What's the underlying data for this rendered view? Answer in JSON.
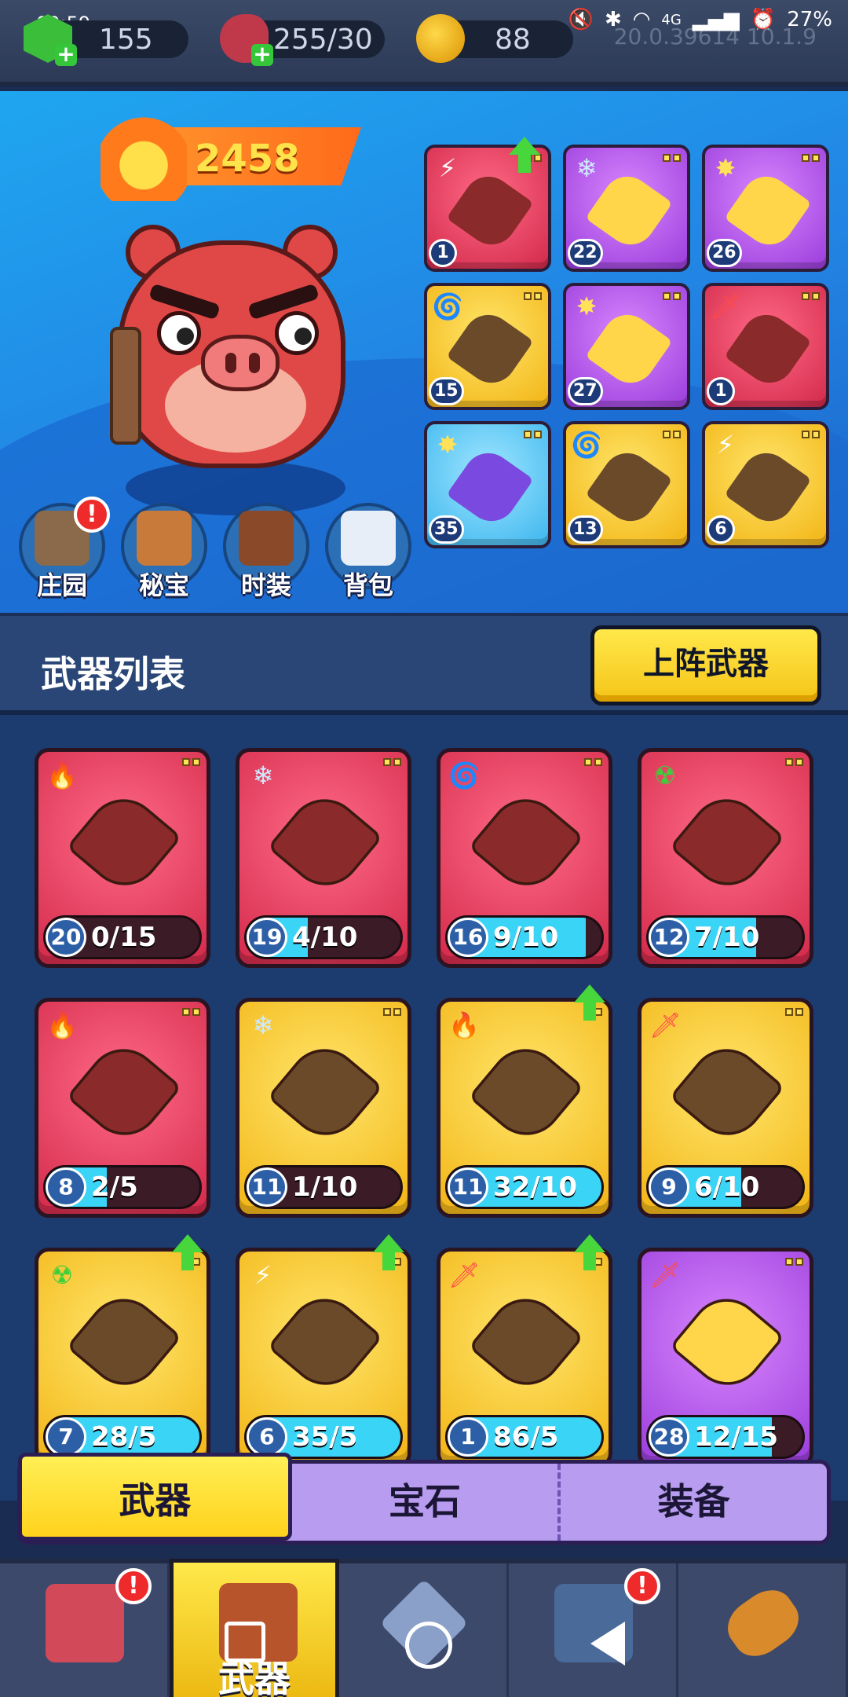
{
  "status": {
    "time": "00:59",
    "battery": "27%",
    "network": "4G",
    "version_text": "20.0.39614 10.1.9"
  },
  "resources": {
    "gems": "155",
    "energy": "255/30",
    "coins": "88"
  },
  "hero": {
    "power": "2458"
  },
  "equipped": [
    {
      "level": "1",
      "element": "lightning",
      "bg": "red",
      "upgrade": true
    },
    {
      "level": "22",
      "element": "ice",
      "bg": "purple"
    },
    {
      "level": "26",
      "element": "burst",
      "bg": "purple"
    },
    {
      "level": "15",
      "element": "wind",
      "bg": "yellow"
    },
    {
      "level": "27",
      "element": "burst",
      "bg": "purple"
    },
    {
      "level": "1",
      "element": "sword",
      "bg": "red"
    },
    {
      "level": "35",
      "element": "burst",
      "bg": "blue"
    },
    {
      "level": "13",
      "element": "wind",
      "bg": "yellow"
    },
    {
      "level": "6",
      "element": "lightning",
      "bg": "yellow"
    }
  ],
  "hero_menu": [
    {
      "label": "庄园",
      "alert": "!"
    },
    {
      "label": "秘宝"
    },
    {
      "label": "时装"
    },
    {
      "label": "背包"
    }
  ],
  "weapon_list": {
    "title": "武器列表",
    "deploy_button": "上阵武器"
  },
  "weapons": [
    {
      "level": "20",
      "count": "0/15",
      "fill": 0.0,
      "bg": "red",
      "element": "fire"
    },
    {
      "level": "19",
      "count": "4/10",
      "fill": 0.4,
      "bg": "red",
      "element": "ice"
    },
    {
      "level": "16",
      "count": "9/10",
      "fill": 0.9,
      "bg": "red",
      "element": "wind"
    },
    {
      "level": "12",
      "count": "7/10",
      "fill": 0.7,
      "bg": "red",
      "element": "poison"
    },
    {
      "level": "8",
      "count": "2/5",
      "fill": 0.4,
      "bg": "red",
      "element": "fire"
    },
    {
      "level": "11",
      "count": "1/10",
      "fill": 0.1,
      "bg": "yellow",
      "element": "ice"
    },
    {
      "level": "11",
      "count": "32/10",
      "fill": 1.0,
      "bg": "yellow",
      "element": "fire",
      "upgrade": true
    },
    {
      "level": "9",
      "count": "6/10",
      "fill": 0.6,
      "bg": "yellow",
      "element": "sword"
    },
    {
      "level": "7",
      "count": "28/5",
      "fill": 1.0,
      "bg": "yellow",
      "element": "poison",
      "upgrade": true
    },
    {
      "level": "6",
      "count": "35/5",
      "fill": 1.0,
      "bg": "yellow",
      "element": "lightning",
      "upgrade": true
    },
    {
      "level": "1",
      "count": "86/5",
      "fill": 1.0,
      "bg": "yellow",
      "element": "sword",
      "upgrade": true
    },
    {
      "level": "28",
      "count": "12/15",
      "fill": 0.8,
      "bg": "purple",
      "element": "sword"
    }
  ],
  "category_tabs": [
    {
      "label": "武器",
      "active": true
    },
    {
      "label": "宝石"
    },
    {
      "label": "装备"
    }
  ],
  "bottom_nav": [
    {
      "name": "shop",
      "alert": "!"
    },
    {
      "name": "weapons",
      "label": "武器",
      "active": true
    },
    {
      "name": "battle"
    },
    {
      "name": "tower",
      "alert": "!"
    },
    {
      "name": "capsule"
    }
  ]
}
